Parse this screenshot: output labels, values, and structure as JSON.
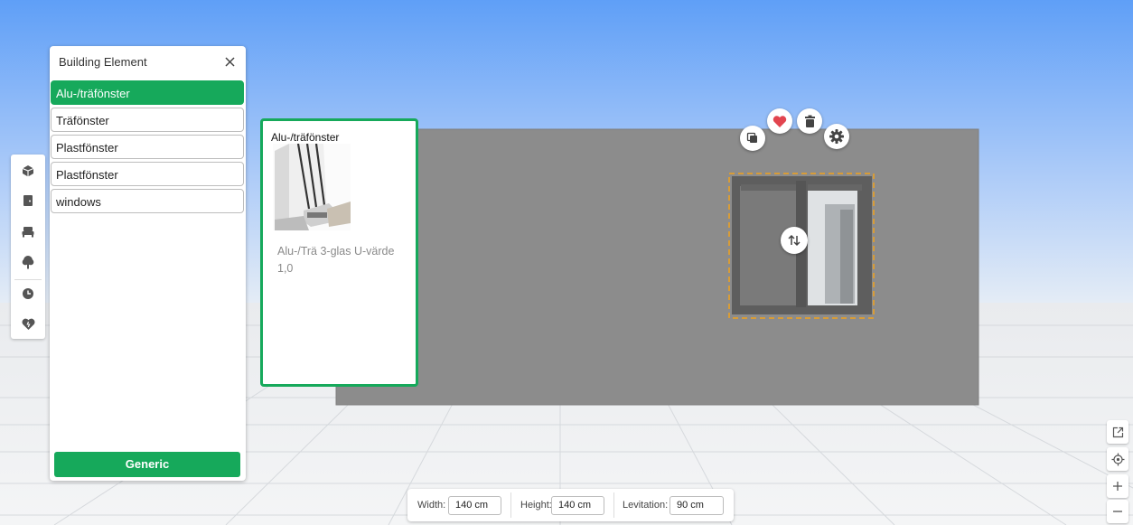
{
  "panel": {
    "title": "Building Element",
    "items": [
      {
        "label": "Alu-/träfönster",
        "active": true
      },
      {
        "label": "Träfönster"
      },
      {
        "label": "Plastfönster"
      },
      {
        "label": "Plastfönster"
      },
      {
        "label": "windows"
      }
    ],
    "generic_button": "Generic"
  },
  "product": {
    "title": "Alu-/träfönster",
    "description": "Alu-/Trä 3-glas U-värde 1,0"
  },
  "toolbar_icons": [
    "building-icon",
    "door-icon",
    "furniture-icon",
    "tree-icon",
    "clock-icon",
    "favorite-heart-icon"
  ],
  "selected_object_actions": [
    "copy-icon",
    "favorite-icon",
    "delete-icon",
    "settings-icon"
  ],
  "right_controls": [
    "open-external-icon",
    "locate-icon",
    "zoom-in-icon",
    "zoom-out-icon"
  ],
  "dimensions": {
    "width_label": "Width:",
    "width_value": "140 cm",
    "height_label": "Height:",
    "height_value": "140 cm",
    "levitation_label": "Levitation:",
    "levitation_value": "90 cm"
  },
  "colors": {
    "accent": "#16a95b",
    "wall": "#8b8b8b",
    "selection": "#f0a21c",
    "favorite": "#e2454f"
  }
}
